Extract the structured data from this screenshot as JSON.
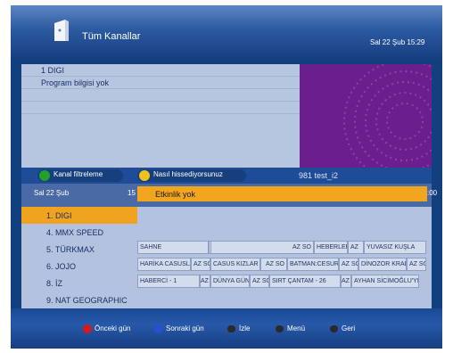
{
  "header": {
    "title": "Tüm Kanallar",
    "datetime": "Sal 22 Şub 15:29"
  },
  "info": {
    "channel": "1  DIGI",
    "program": "Program bilgisi yok"
  },
  "filters": {
    "red_label": "Kanal filtreleme",
    "yellow_label": "Nasıl hissediyorsunuz",
    "message": "981  test_i2"
  },
  "timeline": {
    "date": "Sal 22 Şub",
    "time_left": "15",
    "time_right": ":00"
  },
  "event": {
    "label": "Etkinlik yok"
  },
  "channels": [
    "1. DIGI",
    "4. MMX SPEED",
    "5. TÜRKMAX",
    "6. JOJO",
    "8. İZ",
    "9. NAT GEOGRAPHIC"
  ],
  "epg": {
    "rows": [
      [
        "SAHNE",
        "AZ SO",
        "HEBERLER",
        "AZ",
        "YUVASIZ KUŞLA"
      ],
      [
        "HARİKA CASUSLA",
        "AZ SO",
        "CASUS KIZLAR",
        "AZ SO",
        "BATMAN:CESUR",
        "AZ SO",
        "DİNOZOR KRALI",
        "AZ SO"
      ],
      [
        "HABERCİ - 1",
        "AZ",
        "DÜNYA GÜN",
        "AZ SO",
        "SIRT ÇANTAM - 26",
        "AZ",
        "AYHAN SİCİMOĞLU'YL"
      ]
    ]
  },
  "footer": {
    "prev_day": "Önceki gün",
    "next_day": "Sonraki gün",
    "ok_label": "İzle",
    "menu_label": "Menü",
    "back_label": "Geri"
  },
  "colors": {
    "red": "#d41a1a",
    "yellow": "#f0c21b",
    "blue": "#2a4fd1",
    "green": "#1fa12a",
    "highlight": "#f0a31e"
  }
}
